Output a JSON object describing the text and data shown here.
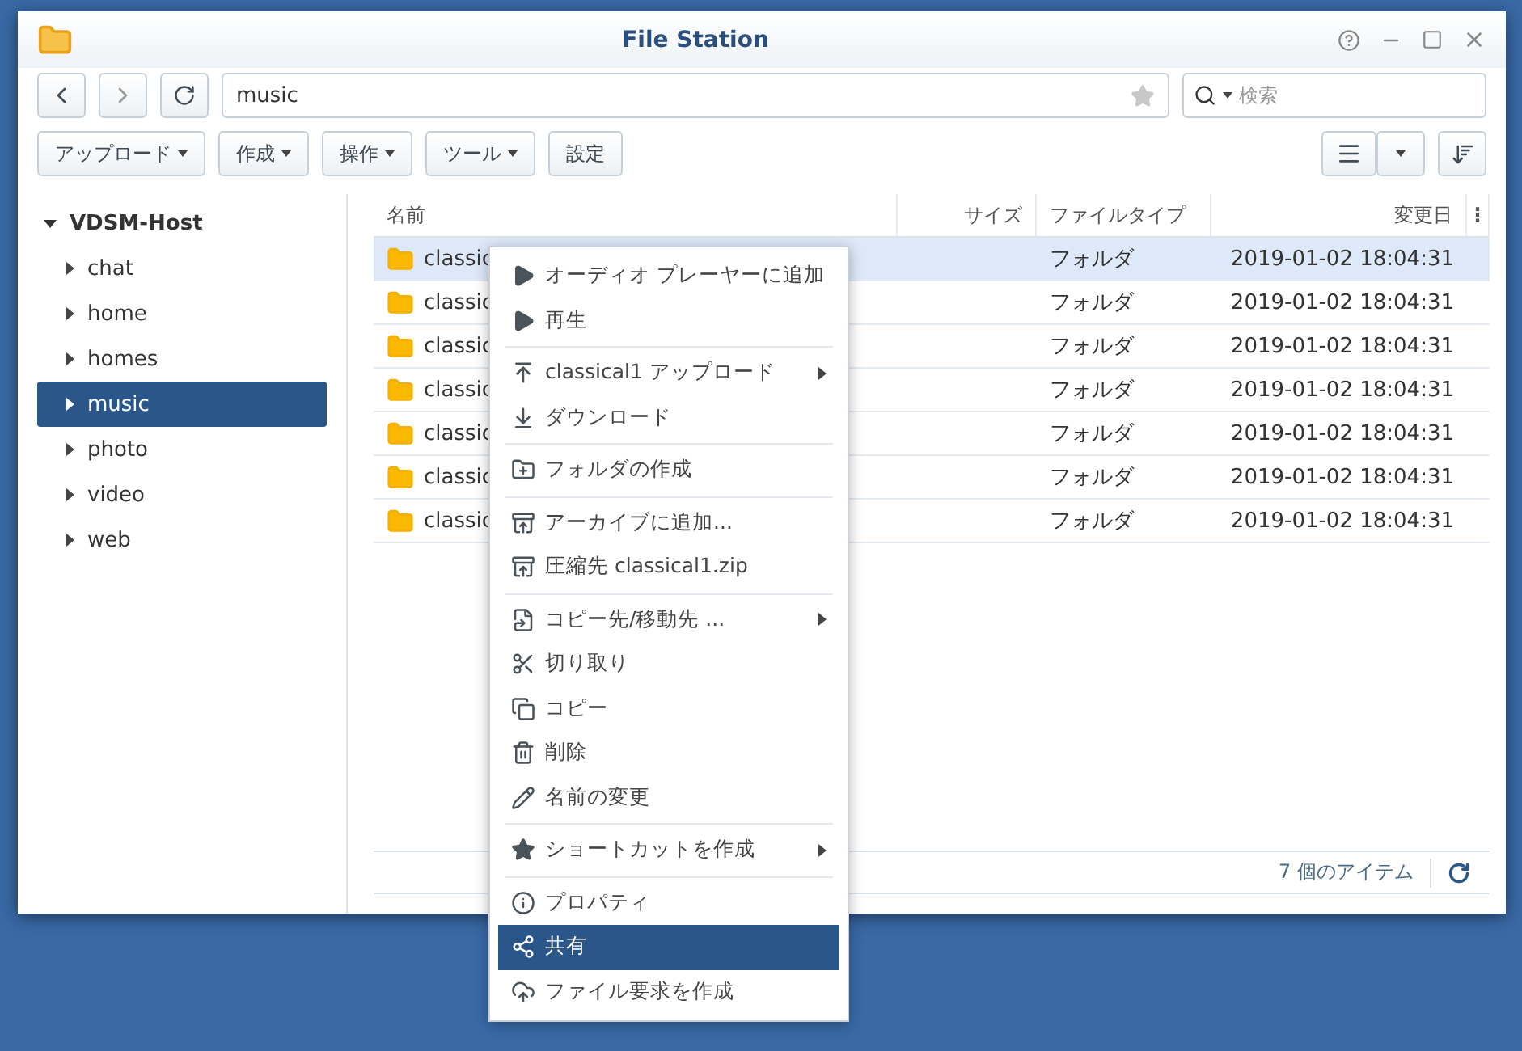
{
  "window": {
    "title": "File Station"
  },
  "nav": {
    "path": "music",
    "search_placeholder": "検索"
  },
  "toolbar": [
    "アップロード",
    "作成",
    "操作",
    "ツール",
    "設定"
  ],
  "tree": {
    "label": "VDSM-Host",
    "expanded": true,
    "children": [
      {
        "label": "chat",
        "selected": false
      },
      {
        "label": "home",
        "selected": false
      },
      {
        "label": "homes",
        "selected": false
      },
      {
        "label": "music",
        "selected": true
      },
      {
        "label": "photo",
        "selected": false
      },
      {
        "label": "video",
        "selected": false
      },
      {
        "label": "web",
        "selected": false
      }
    ]
  },
  "table": {
    "columns": [
      "名前",
      "サイズ",
      "ファイルタイプ",
      "変更日"
    ],
    "column_menu": "⋮",
    "rows": [
      {
        "name": "classic",
        "type": "フォルダ",
        "modified": "2019-01-02 18:04:31",
        "selected": true
      },
      {
        "name": "classic",
        "type": "フォルダ",
        "modified": "2019-01-02 18:04:31",
        "selected": false
      },
      {
        "name": "classic",
        "type": "フォルダ",
        "modified": "2019-01-02 18:04:31",
        "selected": false
      },
      {
        "name": "classic",
        "type": "フォルダ",
        "modified": "2019-01-02 18:04:31",
        "selected": false
      },
      {
        "name": "classic",
        "type": "フォルダ",
        "modified": "2019-01-02 18:04:31",
        "selected": false
      },
      {
        "name": "classic",
        "type": "フォルダ",
        "modified": "2019-01-02 18:04:31",
        "selected": false
      },
      {
        "name": "classic",
        "type": "フォルダ",
        "modified": "2019-01-02 18:04:31",
        "selected": false
      }
    ]
  },
  "status_bar": {
    "count": "7 個のアイテム"
  },
  "context_menu": [
    {
      "kind": "item",
      "label": "オーディオ プレーヤーに追加",
      "submenu": false,
      "selected": false
    },
    {
      "kind": "item",
      "label": "再生",
      "submenu": false,
      "selected": false
    },
    {
      "kind": "separator"
    },
    {
      "kind": "item",
      "label": "classical1 アップロード",
      "submenu": true,
      "selected": false
    },
    {
      "kind": "item",
      "label": "ダウンロード",
      "submenu": false,
      "selected": false
    },
    {
      "kind": "separator"
    },
    {
      "kind": "item",
      "label": "フォルダの作成",
      "submenu": false,
      "selected": false
    },
    {
      "kind": "separator"
    },
    {
      "kind": "item",
      "label": "アーカイブに追加...",
      "submenu": false,
      "selected": false
    },
    {
      "kind": "item",
      "label": "圧縮先 classical1.zip",
      "submenu": false,
      "selected": false
    },
    {
      "kind": "separator"
    },
    {
      "kind": "item",
      "label": "コピー先/移動先 ...",
      "submenu": true,
      "selected": false
    },
    {
      "kind": "item",
      "label": "切り取り",
      "submenu": false,
      "selected": false
    },
    {
      "kind": "item",
      "label": "コピー",
      "submenu": false,
      "selected": false
    },
    {
      "kind": "item",
      "label": "削除",
      "submenu": false,
      "selected": false
    },
    {
      "kind": "item",
      "label": "名前の変更",
      "submenu": false,
      "selected": false
    },
    {
      "kind": "separator"
    },
    {
      "kind": "item",
      "label": "ショートカットを作成",
      "submenu": true,
      "selected": false
    },
    {
      "kind": "separator"
    },
    {
      "kind": "item",
      "label": "プロパティ",
      "submenu": false,
      "selected": false
    },
    {
      "kind": "item",
      "label": "共有",
      "submenu": false,
      "selected": true
    },
    {
      "kind": "item",
      "label": "ファイル要求を作成",
      "submenu": false,
      "selected": false
    }
  ]
}
